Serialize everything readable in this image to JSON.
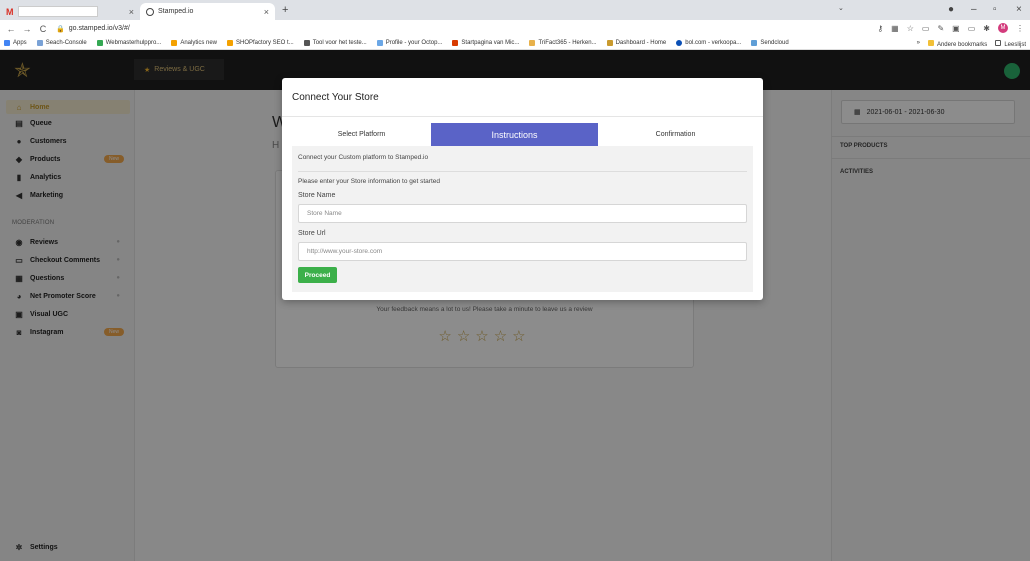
{
  "browser": {
    "tab1_icon": "M",
    "tab2_title": "Stamped.io",
    "url": "go.stamped.io/v3/#/",
    "bookmarks": [
      "Apps",
      "Seach-Console",
      "Webmasterhulppro...",
      "Analytics new",
      "SHOPfactory SEO t...",
      "Tool voor het teste...",
      "Profile - your Octop...",
      "Startpagina van Mic...",
      "TriFact365 - Herken...",
      "Dashboard - Home",
      "bol.com - verkoopa...",
      "Sendcloud"
    ],
    "bookmarks_right": [
      "»",
      "Andere bookmarks",
      "Leeslijst"
    ],
    "profile_initial": "M"
  },
  "header": {
    "tab_label": "Reviews & UGC"
  },
  "sidebar": {
    "items": [
      {
        "label": "Home"
      },
      {
        "label": "Queue"
      },
      {
        "label": "Customers"
      },
      {
        "label": "Products",
        "badge": "New"
      },
      {
        "label": "Analytics"
      },
      {
        "label": "Marketing"
      }
    ],
    "moderation_heading": "MODERATION",
    "moderation_items": [
      {
        "label": "Reviews"
      },
      {
        "label": "Checkout Comments"
      },
      {
        "label": "Questions"
      },
      {
        "label": "Net Promoter Score"
      },
      {
        "label": "Visual UGC"
      },
      {
        "label": "Instagram",
        "badge": "New"
      }
    ],
    "settings_label": "Settings"
  },
  "main": {
    "welcome_partial": "W",
    "sub_partial": "H",
    "feedback_text": "Your feedback means a lot to us! Please take a minute to leave us a review",
    "stars": "☆☆☆☆☆"
  },
  "right_panel": {
    "date_range": "2021-06-01 - 2021-06-30",
    "top_products": "TOP PRODUCTS",
    "activities": "ACTIVITIES"
  },
  "modal": {
    "title": "Connect Your Store",
    "steps": [
      "Select Platform",
      "Instructions",
      "Confirmation"
    ],
    "intro": "Connect your Custom platform to Stamped.io",
    "prompt": "Please enter your Store information to get started",
    "store_name_label": "Store Name",
    "store_name_placeholder": "Store Name",
    "store_url_label": "Store Url",
    "store_url_placeholder": "http://www.your-store.com",
    "proceed_label": "Proceed"
  }
}
